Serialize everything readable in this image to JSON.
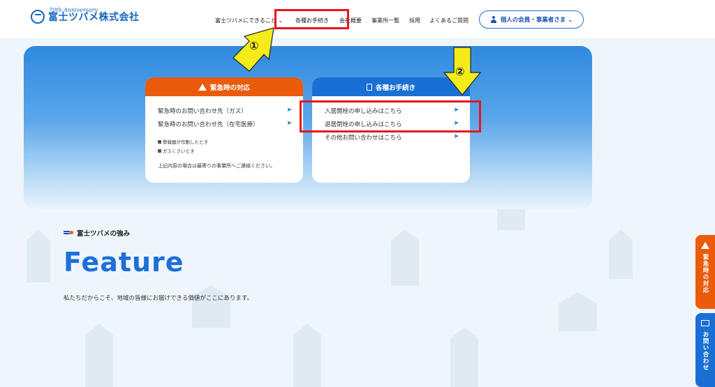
{
  "header": {
    "logo_text": "富士ツバメ株式会社",
    "anniversary": "70th Anniversary",
    "nav": [
      {
        "label": "富士ツバメにできること ⌄"
      },
      {
        "label": "各種お手続き"
      },
      {
        "label": "会社概要"
      },
      {
        "label": "事業所一覧"
      },
      {
        "label": "採用"
      },
      {
        "label": "よくあるご質問"
      }
    ],
    "member_button": "個人の会員・事業者さま ⌄"
  },
  "emergency_card": {
    "title": "緊急時の対応",
    "links": [
      "緊急時のお問い合わせ先（ガス）",
      "緊急時のお問い合わせ先（在宅医療）"
    ],
    "notes": [
      "警報器が作動したとき",
      "ガスくさいとき"
    ],
    "footer": "上記内容の場合は最寄りの事業所へご連絡ください。"
  },
  "procedure_card": {
    "title": "各種お手続き",
    "links": [
      "入居開栓の申し込みはこちら",
      "退居閉栓の申し込みはこちら",
      "その他お問い合わせはこちら"
    ]
  },
  "feature": {
    "eyebrow": "富士ツバメの強み",
    "title": "Feature",
    "description": "私たちだからこそ、地域の皆様にお届けできる価値がここにあります。"
  },
  "side_tabs": {
    "emergency": "緊急時の対応",
    "contact": "お問い合わせ"
  },
  "annotations": {
    "marker1": "①",
    "marker2": "②"
  },
  "colors": {
    "brand_blue": "#1a6fd4",
    "emergency_orange": "#ea5b0c",
    "annotation_red": "#e8151f",
    "annotation_yellow": "#f4ec1a"
  }
}
